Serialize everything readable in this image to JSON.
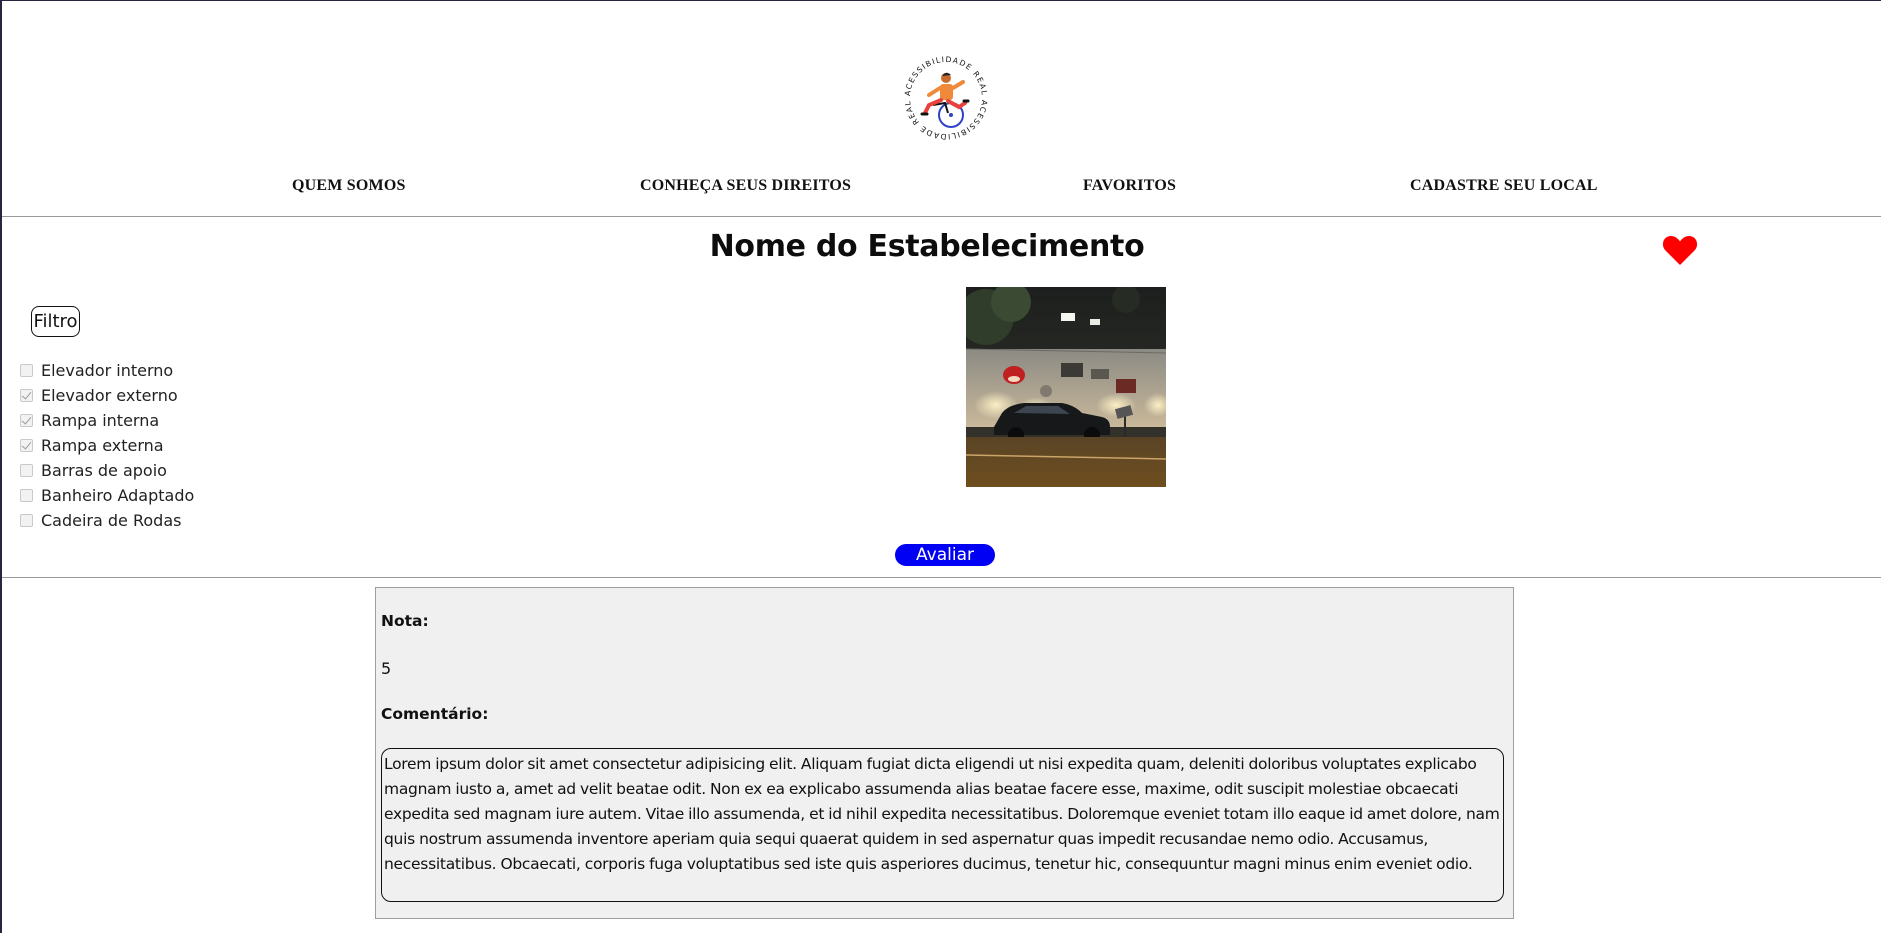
{
  "logo": {
    "text": "ACESSIBILIDADE REAL",
    "alt": "Acessibilidade Real logo"
  },
  "nav": {
    "items": [
      {
        "label": "QUEM SOMOS"
      },
      {
        "label": "CONHEÇA SEUS DIREITOS"
      },
      {
        "label": "FAVORITOS"
      },
      {
        "label": "CADASTRE SEU LOCAL"
      }
    ]
  },
  "establishment": {
    "title": "Nome do Estabelecimento",
    "favorite_icon": "heart-icon",
    "favorite_color": "#ff0000",
    "photo_alt": "Fachada do estabelecimento"
  },
  "filters": {
    "button_label": "Filtro",
    "items": [
      {
        "label": "Elevador interno",
        "checked": false
      },
      {
        "label": "Elevador externo",
        "checked": true
      },
      {
        "label": "Rampa interna",
        "checked": true
      },
      {
        "label": "Rampa externa",
        "checked": true
      },
      {
        "label": "Barras de apoio",
        "checked": false
      },
      {
        "label": "Banheiro Adaptado",
        "checked": false
      },
      {
        "label": "Cadeira de Rodas",
        "checked": false
      }
    ]
  },
  "rate_button": {
    "label": "Avaliar",
    "color": "#0000f5"
  },
  "review": {
    "rating_label": "Nota:",
    "rating_value": "5",
    "comment_label": "Comentário:",
    "comment_text": "Lorem ipsum dolor sit amet consectetur adipisicing elit. Aliquam fugiat dicta eligendi ut nisi expedita quam, deleniti doloribus voluptates explicabo magnam iusto a, amet ad velit beatae odit. Non ex ea explicabo assumenda alias beatae facere esse, maxime, odit suscipit molestiae obcaecati expedita sed magnam iure autem. Vitae illo assumenda, et id nihil expedita necessitatibus. Doloremque eveniet totam illo eaque id amet dolore, nam quis nostrum assumenda inventore aperiam quia sequi quaerat quidem in sed aspernatur quas impedit recusandae nemo odio. Accusamus, necessitatibus. Obcaecati, corporis fuga voluptatibus sed iste quis asperiores ducimus, tenetur hic, consequuntur magni minus enim eveniet odio."
  }
}
